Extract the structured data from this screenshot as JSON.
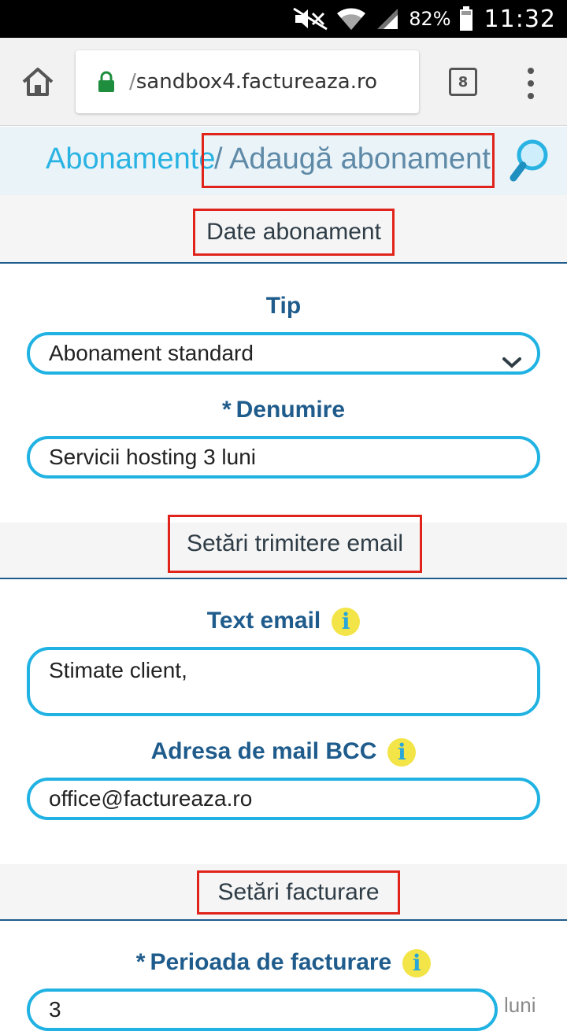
{
  "status_bar": {
    "battery_percent": "82%",
    "time": "11:32",
    "icons": [
      "mute-icon",
      "wifi-icon",
      "signal-icon",
      "battery-icon"
    ]
  },
  "browser": {
    "url": "sandbox4.factureaza.ro",
    "url_prefix": "/",
    "tab_count": "8",
    "icons": [
      "home-icon",
      "lock-icon",
      "tabs-icon",
      "overflow-menu-icon"
    ]
  },
  "breadcrumb": {
    "root": "Abonamente",
    "separator": "/",
    "current": "Adaugă abonament"
  },
  "sections": {
    "date_abonament": {
      "title": "Date abonament",
      "tip_label": "Tip",
      "tip_value": "Abonament standard",
      "denumire_required": "*",
      "denumire_label": "Denumire",
      "denumire_value": "Servicii hosting 3 luni"
    },
    "email": {
      "title": "Setări trimitere email",
      "text_email_label": "Text email",
      "text_email_value": "Stimate client,",
      "bcc_label": "Adresa de mail BCC",
      "bcc_value": "office@factureaza.ro",
      "info_glyph": "i"
    },
    "facturare": {
      "title": "Setări facturare",
      "perioada_required": "*",
      "perioada_label": "Perioada de facturare",
      "perioada_value": "3",
      "perioada_unit": "luni",
      "info_glyph": "i"
    }
  },
  "colors": {
    "accent": "#1fb2e3",
    "label": "#1f5c8c",
    "highlight_box": "#e0241b",
    "info_badge": "#f3e447"
  }
}
